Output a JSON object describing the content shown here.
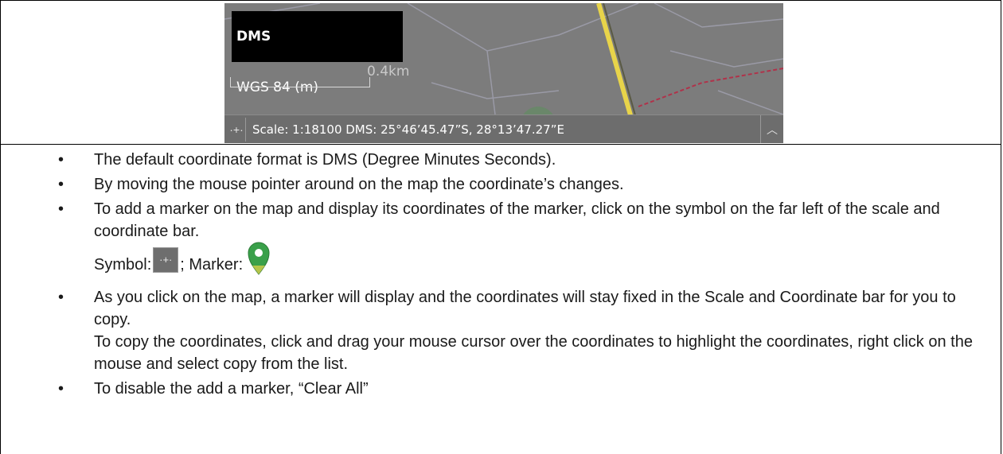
{
  "map_panel": {
    "format_options": [
      "DMS",
      "WGS 84 (m)"
    ],
    "selected_format": "DMS",
    "scale_label": "0.4km",
    "coordinate_bar_text": "Scale: 1:18100 DMS: 25°46’45.47”S, 28°13’47.27”E",
    "marker_tool_icon": "crosshair-icon",
    "collapse_icon": "chevron-up-icon"
  },
  "notes": {
    "b1": "The default coordinate format is DMS (Degree Minutes Seconds).",
    "b2": "By moving the mouse pointer around on the map the coordinate’s changes.",
    "b3": "To add a marker on the map and display its coordinates of the marker, click on the symbol on the far left of the scale and coordinate bar.",
    "symbol_label": "Symbol:",
    "marker_label": "; Marker:",
    "b4a": "As you click on the map, a marker will display and the coordinates will stay fixed in the Scale and Coordinate bar for you to copy.",
    "b4b": "To copy the coordinates, click and drag your mouse cursor over the coordinates to highlight the coordinates, right click on the mouse and select copy from the list.",
    "b5": "To disable the add a marker, “Clear All”"
  },
  "colors": {
    "marker_green": "#3aa04a",
    "map_gray": "#7a7a7a",
    "road_yellow": "#e8d44a",
    "road_red": "#b0324a"
  }
}
